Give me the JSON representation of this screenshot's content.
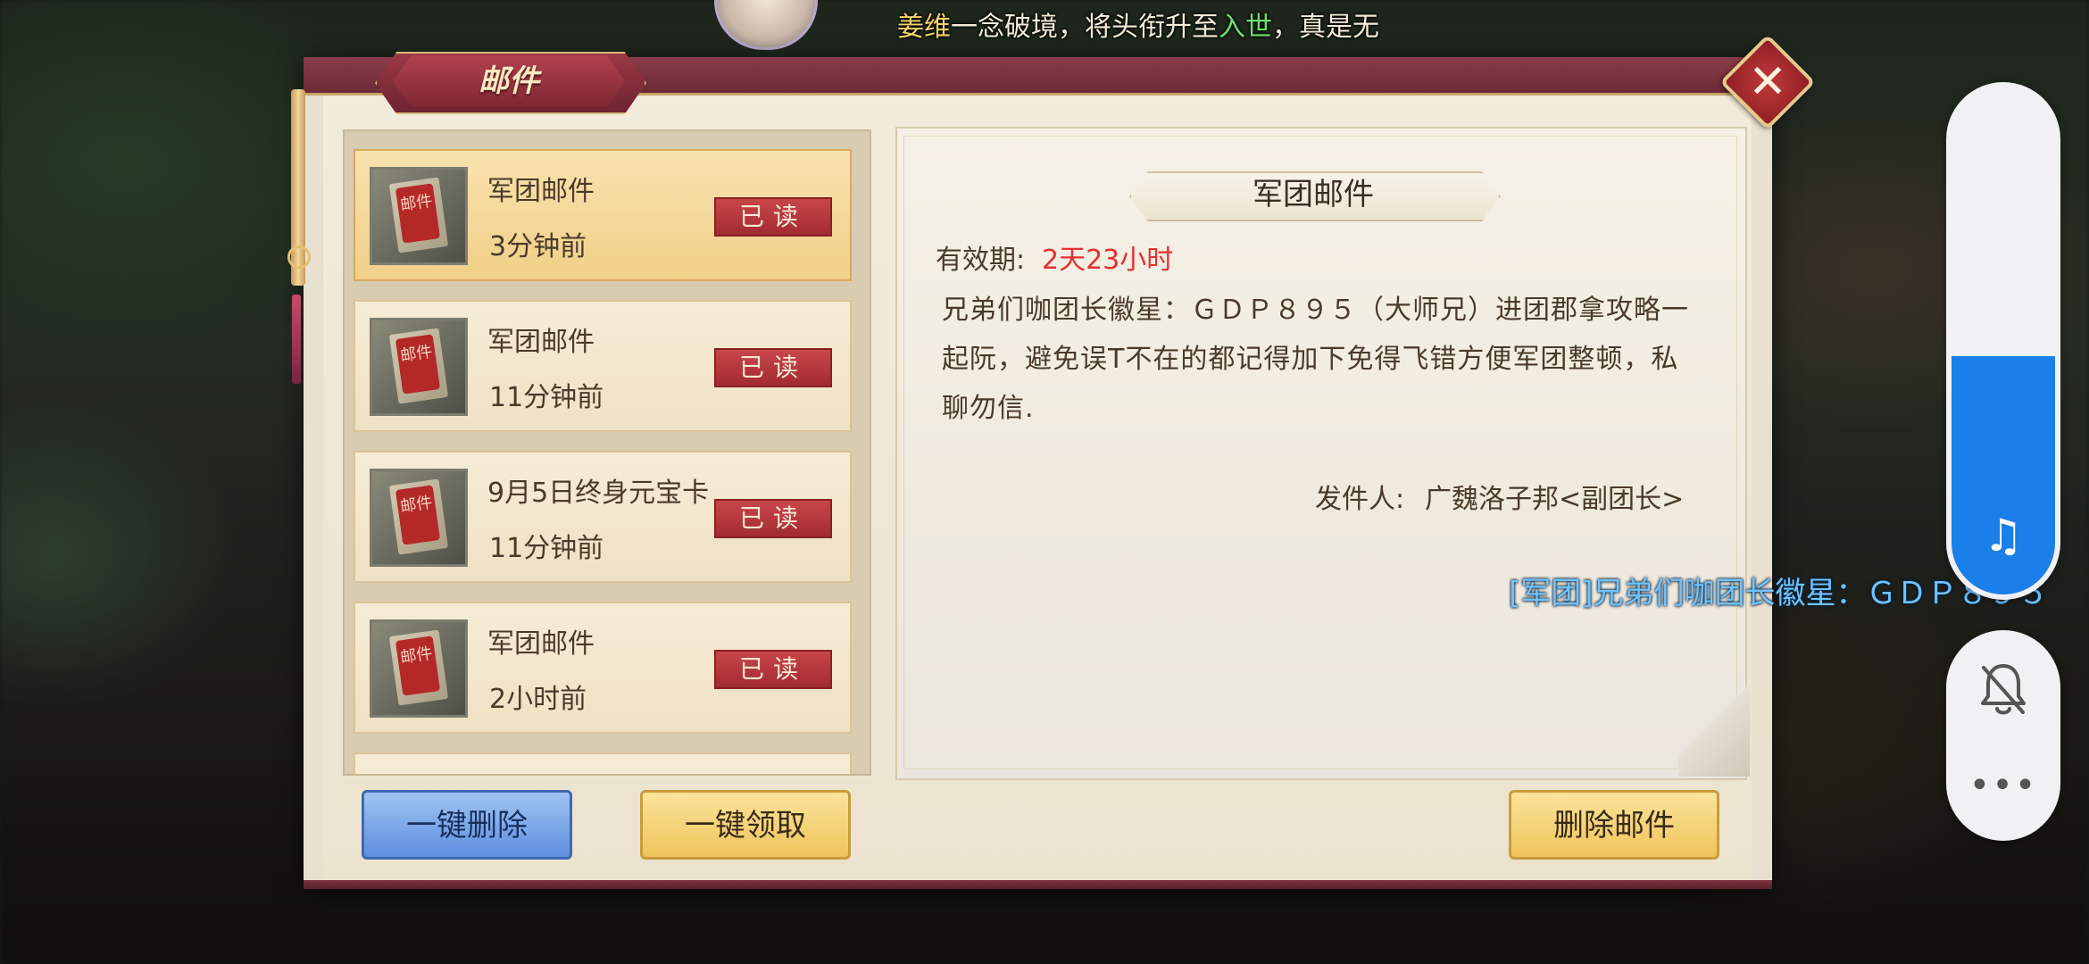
{
  "marquee": {
    "name": "姜维",
    "text_before_rank": "一念破境，将头衔升至",
    "rank": "入世",
    "text_after_rank": "，真是无"
  },
  "dialog": {
    "title": "邮件"
  },
  "mail_list": [
    {
      "title": "军团邮件",
      "time": "3分钟前",
      "status": "已读",
      "selected": true
    },
    {
      "title": "军团邮件",
      "time": "11分钟前",
      "status": "已读",
      "selected": false
    },
    {
      "title": "9月5日终身元宝卡",
      "time": "11分钟前",
      "status": "已读",
      "selected": false
    },
    {
      "title": "军团邮件",
      "time": "2小时前",
      "status": "已读",
      "selected": false
    }
  ],
  "mail_icon_text": "邮件",
  "buttons": {
    "delete_all": "一键删除",
    "claim_all": "一键领取",
    "delete_mail": "删除邮件"
  },
  "detail": {
    "title": "军团邮件",
    "validity_label": "有效期:",
    "validity_value": "2天23小时",
    "content": "兄弟们咖团长徽星：ＧＤＰ８９５（大师兄）进团郡拿攻略一起阮，避免误T不在的都记得加下免得飞错方便军团整顿，私聊勿信.",
    "sender_label": "发件人:",
    "sender_value": "广魏洛子邦<副团长>"
  },
  "chat_line": "[军团]兄弟们咖团长徽星：ＧＤＰ８９５",
  "system": {
    "volume_level": 0.47,
    "accent": "#1a7fe8",
    "music_icon": "music-note",
    "ringer_icon": "bell-off",
    "more_icon": "more-dots"
  }
}
